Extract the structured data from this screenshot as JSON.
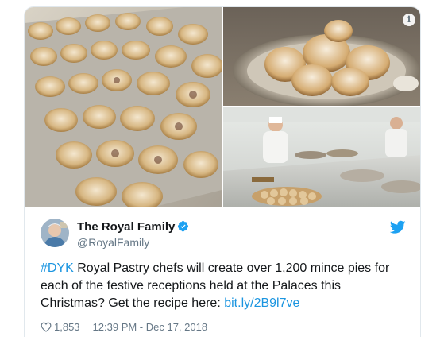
{
  "media": {
    "photos": [
      {
        "alt_icon": "mince-pies-tray-photo"
      },
      {
        "alt_icon": "mince-pies-silver-platter-photo"
      },
      {
        "alt_icon": "pastry-chefs-kitchen-photo"
      }
    ],
    "info_glyph": "i"
  },
  "author": {
    "name": "The Royal Family",
    "handle": "@RoyalFamily",
    "verified": true
  },
  "tweet": {
    "hashtag": "#DYK",
    "text": " Royal Pastry chefs will create over 1,200 mince pies for each of the festive receptions held at the Palaces this Christmas? Get the recipe here: ",
    "link": "bit.ly/2B9l7ve"
  },
  "meta": {
    "likes": "1,853",
    "timestamp": "12:39 PM - Dec 17, 2018"
  },
  "colors": {
    "accent": "#1b95e0",
    "twitter_blue": "#1da1f2",
    "secondary_text": "#657786",
    "like_icon": "#657786"
  }
}
